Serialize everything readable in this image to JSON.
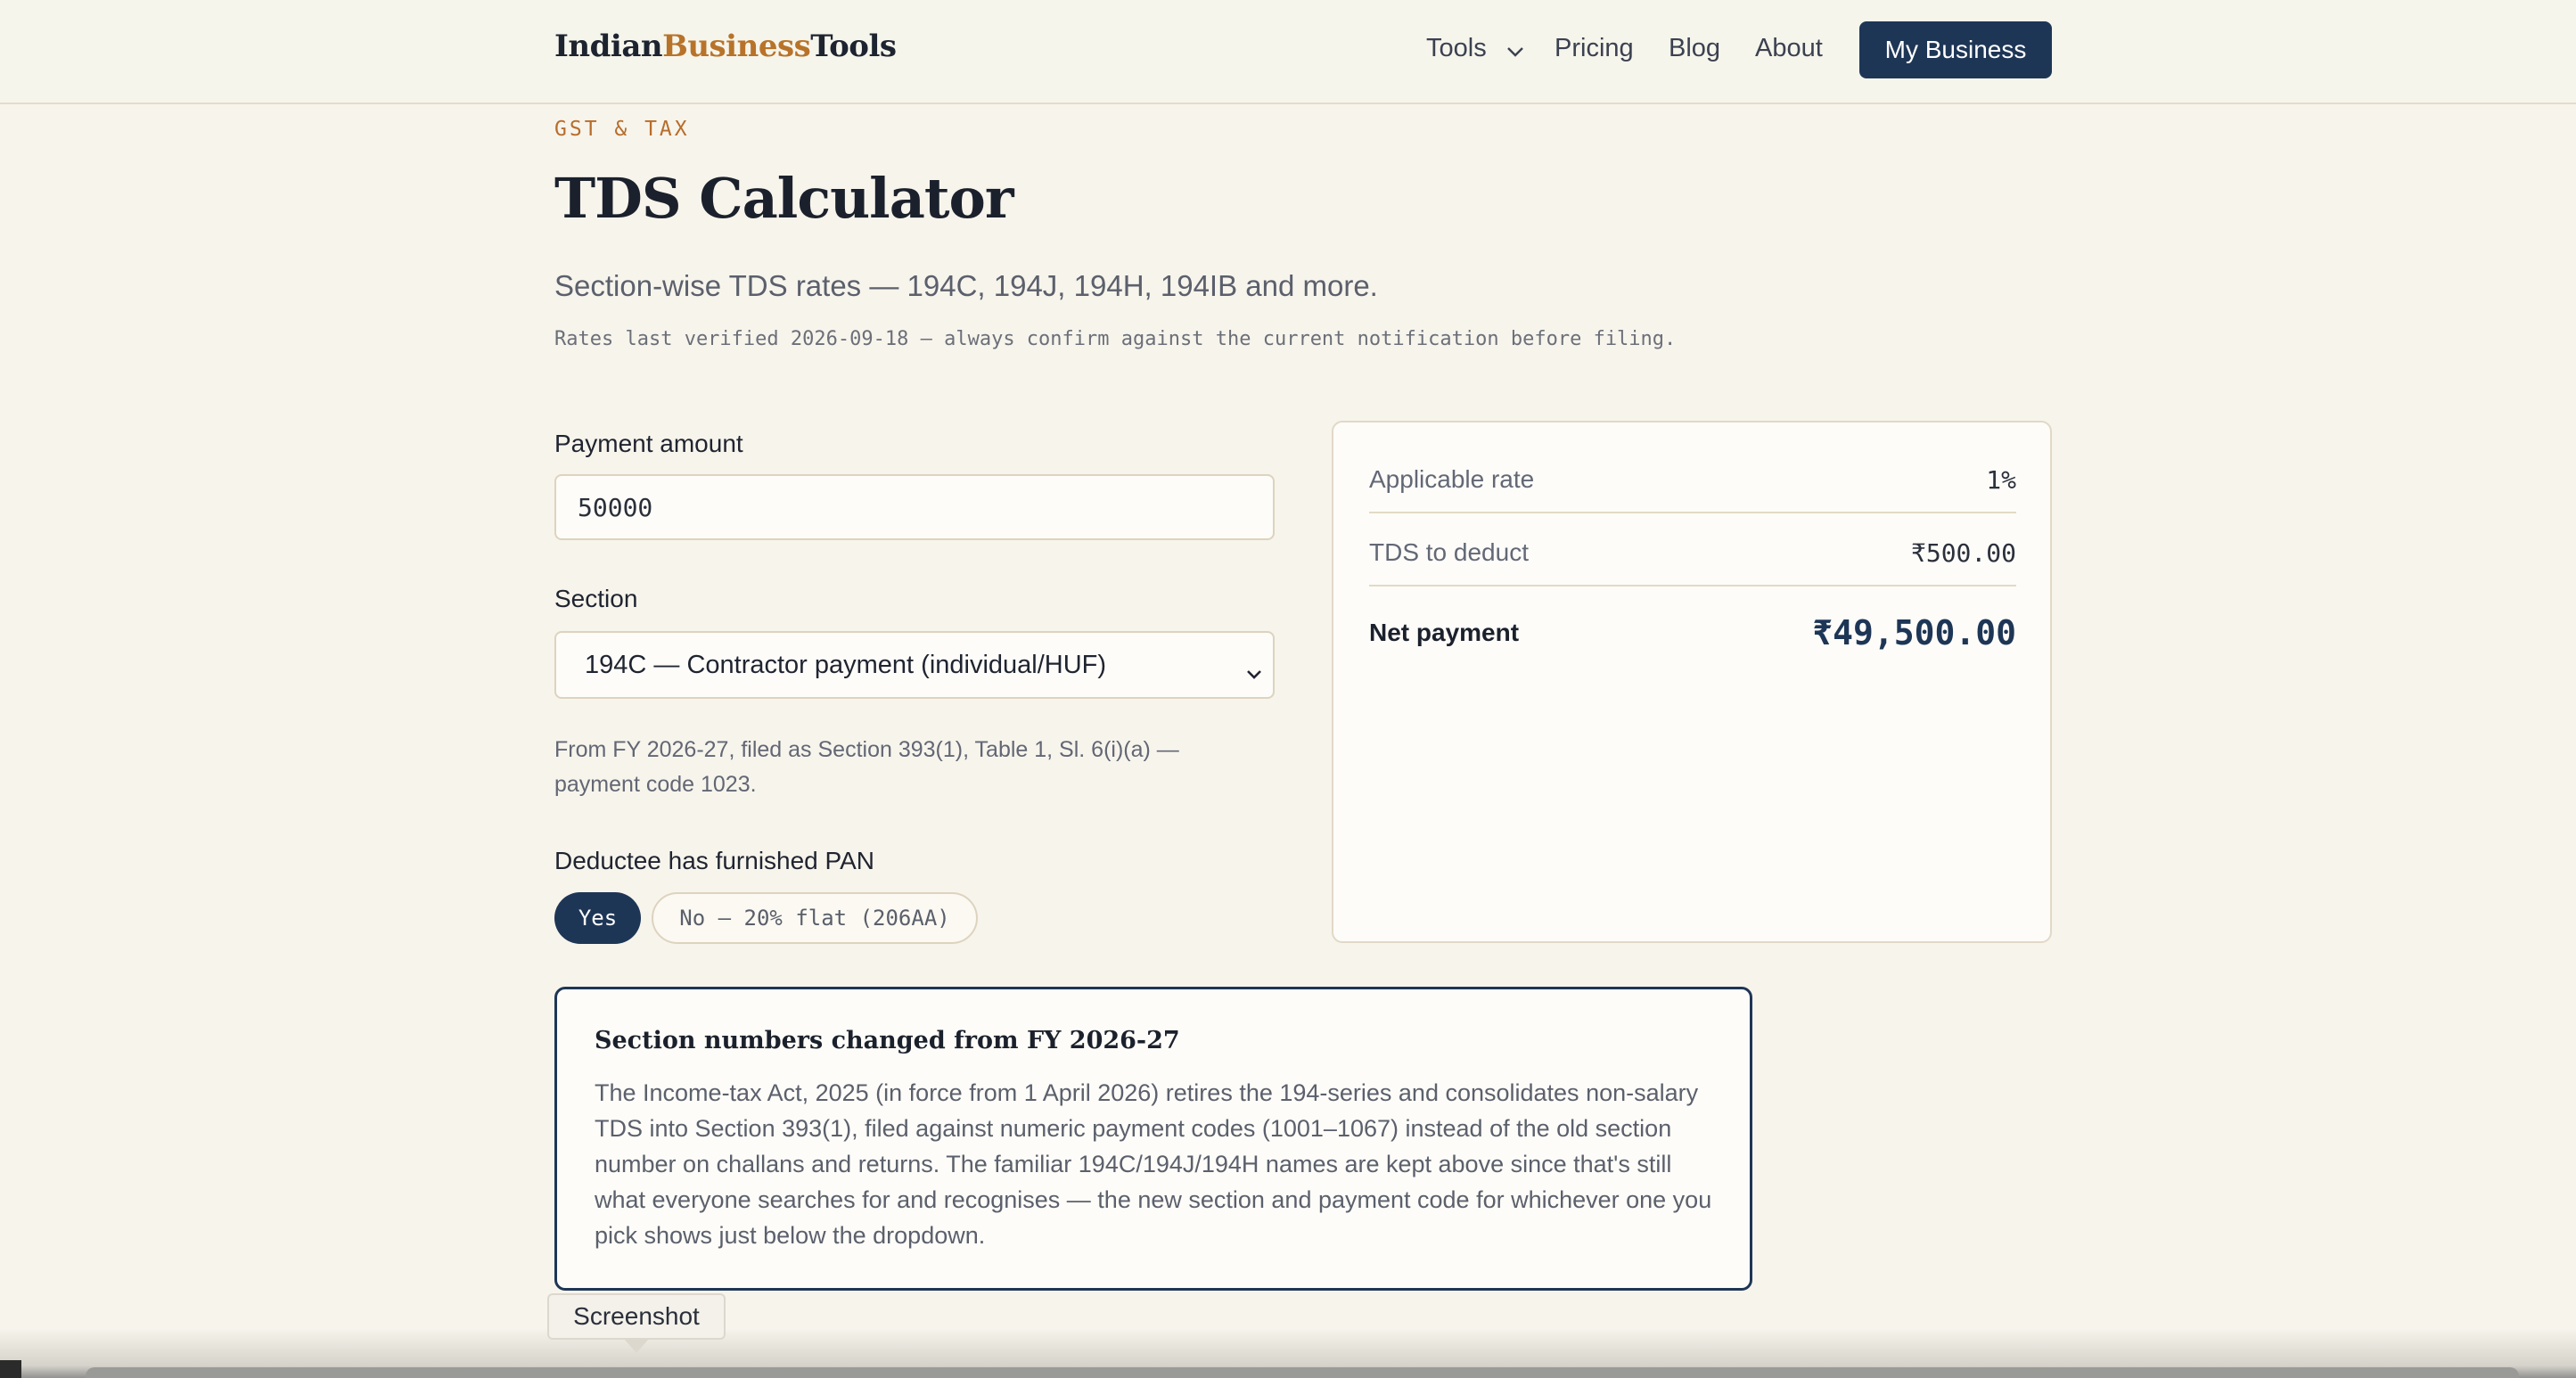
{
  "header": {
    "logo_part1": "Indian",
    "logo_part2": "Business",
    "logo_part3": "Tools",
    "nav": {
      "tools": "Tools",
      "pricing": "Pricing",
      "blog": "Blog",
      "about": "About"
    },
    "cta": "My Business"
  },
  "intro": {
    "eyebrow": "GST & TAX",
    "title": "TDS Calculator",
    "subtitle": "Section-wise TDS rates — 194C, 194J, 194H, 194IB and more.",
    "verified": "Rates last verified 2026-09-18 — always confirm against the current notification before filing."
  },
  "form": {
    "amount_label": "Payment amount",
    "amount_value": "50000",
    "section_label": "Section",
    "section_value": "194C — Contractor payment (individual/HUF)",
    "section_note": "From FY 2026-27, filed as Section 393(1), Table 1, Sl. 6(i)(a) — payment code 1023.",
    "pan_label": "Deductee has furnished PAN",
    "pan_yes": "Yes",
    "pan_no": "No — 20% flat (206AA)"
  },
  "result": {
    "rate_label": "Applicable rate",
    "rate_value": "1%",
    "tds_label": "TDS to deduct",
    "tds_value": "₹500.00",
    "net_label": "Net payment",
    "net_value": "₹49,500.00"
  },
  "notice": {
    "title": "Section numbers changed from FY 2026-27",
    "body": "The Income-tax Act, 2025 (in force from 1 April 2026) retires the 194-series and consolidates non-salary TDS into Section 393(1), filed against numeric payment codes (1001–1067) instead of the old section number on challans and returns. The familiar 194C/194J/194H names are kept above since that's still what everyone searches for and recognises — the new section and payment code for whichever one you pick shows just below the dropdown."
  },
  "tooltip": "Screenshot",
  "colors": {
    "brand_navy": "#1e3656",
    "accent_orange": "#b8732a",
    "background": "#f7f4ec"
  },
  "icons": {
    "tools_dropdown": "chevron-down-icon",
    "section_dropdown": "chevron-down-icon"
  }
}
